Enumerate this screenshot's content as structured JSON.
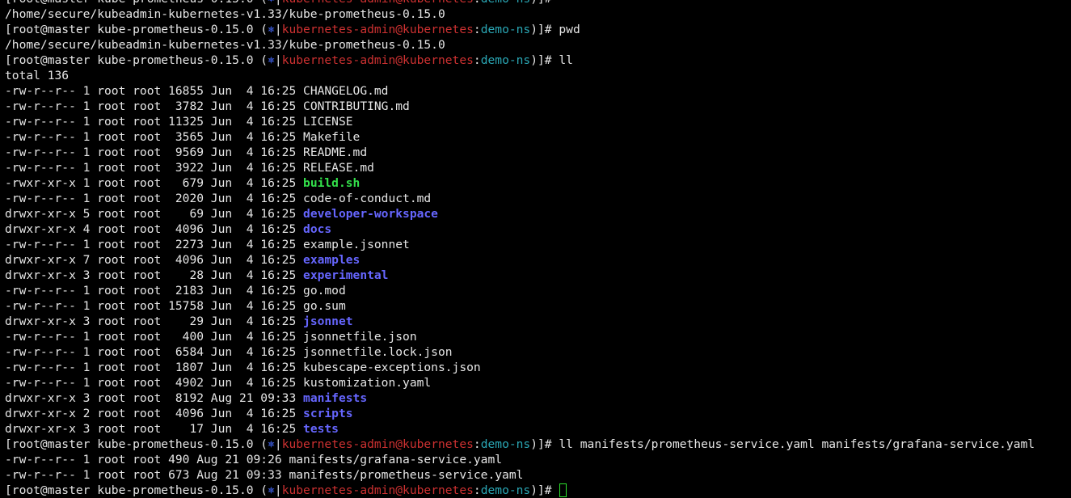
{
  "terminal": {
    "prompt": {
      "user_host": "[root@master kube-prometheus-0.15.0 (",
      "k8s_icon": "⎈",
      "sep": "|",
      "context": "kubernetes-admin@kubernetes",
      "colon": ":",
      "namespace": "demo-ns",
      "close": ")]# "
    },
    "colors": {
      "context": "#cd3131",
      "namespace": "#2aa7b5",
      "directory": "#6666ff",
      "executable": "#33e14b",
      "cursor": "#2ce02c"
    },
    "lines": [
      {
        "kind": "prompt",
        "command": ""
      },
      {
        "kind": "output",
        "segments": [
          {
            "t": "/home/secure/kubeadmin-kubernetes-v1.33/kube-prometheus-0.15.0",
            "c": "default"
          }
        ]
      },
      {
        "kind": "prompt",
        "command": "pwd"
      },
      {
        "kind": "output",
        "segments": [
          {
            "t": "/home/secure/kubeadmin-kubernetes-v1.33/kube-prometheus-0.15.0",
            "c": "default"
          }
        ]
      },
      {
        "kind": "prompt",
        "command": "ll"
      },
      {
        "kind": "output",
        "segments": [
          {
            "t": "total 136",
            "c": "default"
          }
        ]
      },
      {
        "kind": "output",
        "segments": [
          {
            "t": "-rw-r--r-- 1 root root 16855 Jun  4 16:25 ",
            "c": "default"
          },
          {
            "t": "CHANGELOG.md",
            "c": "default"
          }
        ]
      },
      {
        "kind": "output",
        "segments": [
          {
            "t": "-rw-r--r-- 1 root root  3782 Jun  4 16:25 ",
            "c": "default"
          },
          {
            "t": "CONTRIBUTING.md",
            "c": "default"
          }
        ]
      },
      {
        "kind": "output",
        "segments": [
          {
            "t": "-rw-r--r-- 1 root root 11325 Jun  4 16:25 ",
            "c": "default"
          },
          {
            "t": "LICENSE",
            "c": "default"
          }
        ]
      },
      {
        "kind": "output",
        "segments": [
          {
            "t": "-rw-r--r-- 1 root root  3565 Jun  4 16:25 ",
            "c": "default"
          },
          {
            "t": "Makefile",
            "c": "default"
          }
        ]
      },
      {
        "kind": "output",
        "segments": [
          {
            "t": "-rw-r--r-- 1 root root  9569 Jun  4 16:25 ",
            "c": "default"
          },
          {
            "t": "README.md",
            "c": "default"
          }
        ]
      },
      {
        "kind": "output",
        "segments": [
          {
            "t": "-rw-r--r-- 1 root root  3922 Jun  4 16:25 ",
            "c": "default"
          },
          {
            "t": "RELEASE.md",
            "c": "default"
          }
        ]
      },
      {
        "kind": "output",
        "segments": [
          {
            "t": "-rwxr-xr-x 1 root root   679 Jun  4 16:25 ",
            "c": "default"
          },
          {
            "t": "build.sh",
            "c": "exec"
          }
        ]
      },
      {
        "kind": "output",
        "segments": [
          {
            "t": "-rw-r--r-- 1 root root  2020 Jun  4 16:25 ",
            "c": "default"
          },
          {
            "t": "code-of-conduct.md",
            "c": "default"
          }
        ]
      },
      {
        "kind": "output",
        "segments": [
          {
            "t": "drwxr-xr-x 5 root root    69 Jun  4 16:25 ",
            "c": "default"
          },
          {
            "t": "developer-workspace",
            "c": "dir"
          }
        ]
      },
      {
        "kind": "output",
        "segments": [
          {
            "t": "drwxr-xr-x 4 root root  4096 Jun  4 16:25 ",
            "c": "default"
          },
          {
            "t": "docs",
            "c": "dir"
          }
        ]
      },
      {
        "kind": "output",
        "segments": [
          {
            "t": "-rw-r--r-- 1 root root  2273 Jun  4 16:25 ",
            "c": "default"
          },
          {
            "t": "example.jsonnet",
            "c": "default"
          }
        ]
      },
      {
        "kind": "output",
        "segments": [
          {
            "t": "drwxr-xr-x 7 root root  4096 Jun  4 16:25 ",
            "c": "default"
          },
          {
            "t": "examples",
            "c": "dir"
          }
        ]
      },
      {
        "kind": "output",
        "segments": [
          {
            "t": "drwxr-xr-x 3 root root    28 Jun  4 16:25 ",
            "c": "default"
          },
          {
            "t": "experimental",
            "c": "dir"
          }
        ]
      },
      {
        "kind": "output",
        "segments": [
          {
            "t": "-rw-r--r-- 1 root root  2183 Jun  4 16:25 ",
            "c": "default"
          },
          {
            "t": "go.mod",
            "c": "default"
          }
        ]
      },
      {
        "kind": "output",
        "segments": [
          {
            "t": "-rw-r--r-- 1 root root 15758 Jun  4 16:25 ",
            "c": "default"
          },
          {
            "t": "go.sum",
            "c": "default"
          }
        ]
      },
      {
        "kind": "output",
        "segments": [
          {
            "t": "drwxr-xr-x 3 root root    29 Jun  4 16:25 ",
            "c": "default"
          },
          {
            "t": "jsonnet",
            "c": "dir"
          }
        ]
      },
      {
        "kind": "output",
        "segments": [
          {
            "t": "-rw-r--r-- 1 root root   400 Jun  4 16:25 ",
            "c": "default"
          },
          {
            "t": "jsonnetfile.json",
            "c": "default"
          }
        ]
      },
      {
        "kind": "output",
        "segments": [
          {
            "t": "-rw-r--r-- 1 root root  6584 Jun  4 16:25 ",
            "c": "default"
          },
          {
            "t": "jsonnetfile.lock.json",
            "c": "default"
          }
        ]
      },
      {
        "kind": "output",
        "segments": [
          {
            "t": "-rw-r--r-- 1 root root  1807 Jun  4 16:25 ",
            "c": "default"
          },
          {
            "t": "kubescape-exceptions.json",
            "c": "default"
          }
        ]
      },
      {
        "kind": "output",
        "segments": [
          {
            "t": "-rw-r--r-- 1 root root  4902 Jun  4 16:25 ",
            "c": "default"
          },
          {
            "t": "kustomization.yaml",
            "c": "default"
          }
        ]
      },
      {
        "kind": "output",
        "segments": [
          {
            "t": "drwxr-xr-x 3 root root  8192 Aug 21 09:33 ",
            "c": "default"
          },
          {
            "t": "manifests",
            "c": "dir"
          }
        ]
      },
      {
        "kind": "output",
        "segments": [
          {
            "t": "drwxr-xr-x 2 root root  4096 Jun  4 16:25 ",
            "c": "default"
          },
          {
            "t": "scripts",
            "c": "dir"
          }
        ]
      },
      {
        "kind": "output",
        "segments": [
          {
            "t": "drwxr-xr-x 3 root root    17 Jun  4 16:25 ",
            "c": "default"
          },
          {
            "t": "tests",
            "c": "dir"
          }
        ]
      },
      {
        "kind": "prompt",
        "command": "ll manifests/prometheus-service.yaml manifests/grafana-service.yaml"
      },
      {
        "kind": "output",
        "segments": [
          {
            "t": "-rw-r--r-- 1 root root 490 Aug 21 09:26 manifests/grafana-service.yaml",
            "c": "default"
          }
        ]
      },
      {
        "kind": "output",
        "segments": [
          {
            "t": "-rw-r--r-- 1 root root 673 Aug 21 09:33 manifests/prometheus-service.yaml",
            "c": "default"
          }
        ]
      },
      {
        "kind": "prompt",
        "command": "",
        "cursor": true
      }
    ]
  }
}
